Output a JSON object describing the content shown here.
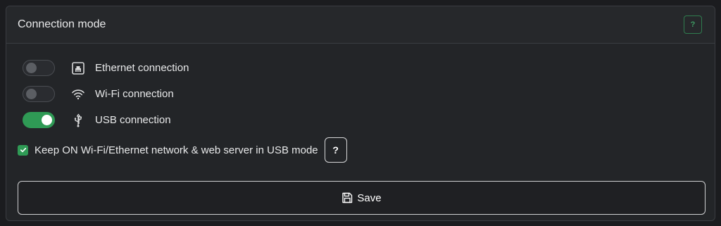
{
  "panel": {
    "title": "Connection mode",
    "help_label": "?"
  },
  "modes": [
    {
      "label": "Ethernet connection",
      "enabled": false,
      "icon": "ethernet-icon"
    },
    {
      "label": "Wi-Fi connection",
      "enabled": false,
      "icon": "wifi-icon"
    },
    {
      "label": "USB connection",
      "enabled": true,
      "icon": "usb-icon"
    }
  ],
  "keep_on": {
    "label": "Keep ON Wi-Fi/Ethernet network & web server in USB mode",
    "checked": true,
    "help_label": "?"
  },
  "save": {
    "label": "Save",
    "icon": "floppy-disk-icon"
  },
  "colors": {
    "accent_green": "#2f9a55",
    "background": "#1b1c1f",
    "panel": "#232528"
  }
}
